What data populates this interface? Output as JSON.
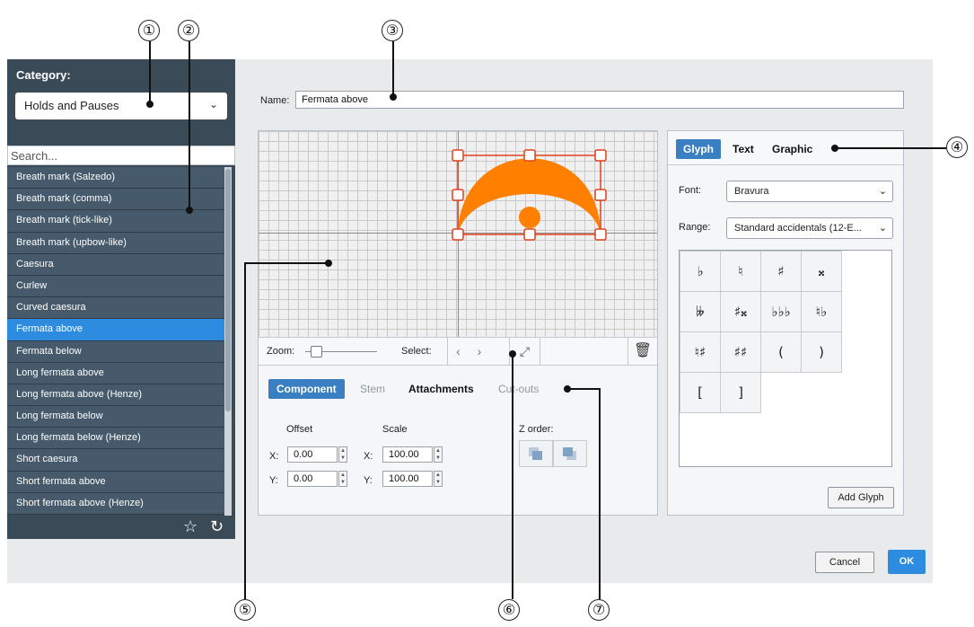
{
  "callouts": [
    "①",
    "②",
    "③",
    "④",
    "⑤",
    "⑥",
    "⑦"
  ],
  "category": {
    "label": "Category:",
    "selected": "Holds and Pauses"
  },
  "search": {
    "placeholder": "Search..."
  },
  "list": [
    "Breath mark (Salzedo)",
    "Breath mark (comma)",
    "Breath mark (tick-like)",
    "Breath mark (upbow-like)",
    "Caesura",
    "Curlew",
    "Curved caesura",
    "Fermata above",
    "Fermata below",
    "Long fermata above",
    "Long fermata above (Henze)",
    "Long fermata below",
    "Long fermata below (Henze)",
    "Short caesura",
    "Short fermata above",
    "Short fermata above (Henze)"
  ],
  "selected_index": 7,
  "name": {
    "label": "Name:",
    "value": "Fermata above"
  },
  "toolbar": {
    "zoom_label": "Zoom:",
    "select_label": "Select:"
  },
  "editor_tabs": {
    "component": "Component",
    "stem": "Stem",
    "attachments": "Attachments",
    "cutouts": "Cut-outs"
  },
  "offset": {
    "label": "Offset",
    "x_label": "X:",
    "y_label": "Y:",
    "x": "0.00",
    "y": "0.00"
  },
  "scale": {
    "label": "Scale",
    "x_label": "X:",
    "y_label": "Y:",
    "x": "100.00",
    "y": "100.00"
  },
  "zorder": {
    "label": "Z order:"
  },
  "right_tabs": {
    "glyph": "Glyph",
    "text": "Text",
    "graphic": "Graphic"
  },
  "font": {
    "label": "Font:",
    "value": "Bravura"
  },
  "range": {
    "label": "Range:",
    "value": "Standard accidentals (12-E..."
  },
  "glyphs": [
    "♭",
    "♮",
    "♯",
    "𝄪",
    "𝄫",
    "♯𝄪",
    "♭♭♭",
    "♮♭",
    "♮♯",
    "♯♯",
    "(",
    ")",
    "[",
    "]"
  ],
  "buttons": {
    "add_glyph": "Add Glyph",
    "cancel": "Cancel",
    "ok": "OK"
  },
  "colors": {
    "accent": "#2e8ce0",
    "fermata": "#ff7f00",
    "handle": "#e0401a",
    "sidebar": "#3b4a57"
  }
}
